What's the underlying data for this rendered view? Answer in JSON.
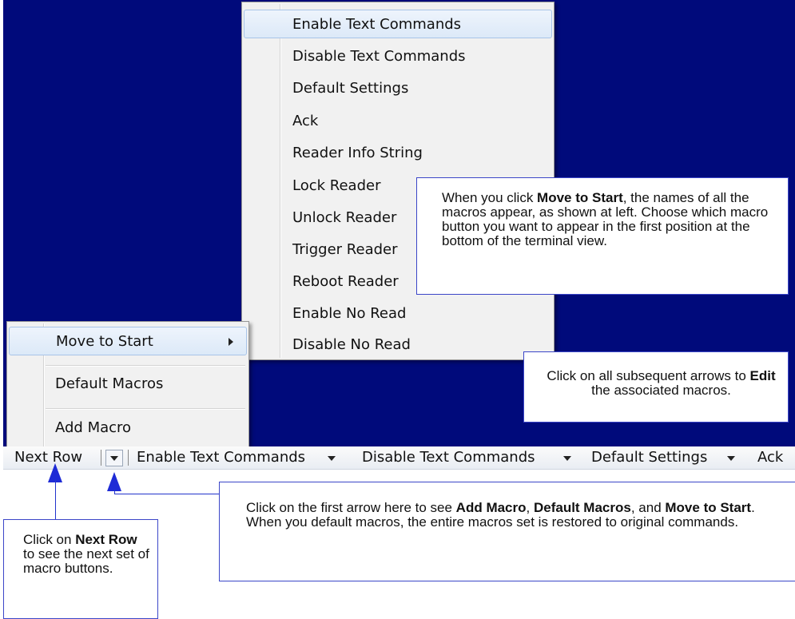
{
  "toolbar": {
    "next_row": "Next Row",
    "items": [
      "Enable Text Commands",
      "Disable Text Commands",
      "Default Settings",
      "Ack"
    ]
  },
  "macro_list_menu": {
    "items": [
      "Enable Text Commands",
      "Disable Text Commands",
      "Default Settings",
      "Ack",
      "Reader Info String",
      "Lock Reader",
      "Unlock Reader",
      "Trigger Reader",
      "Reboot Reader",
      "Enable No Read",
      "Disable No Read"
    ]
  },
  "context_menu": {
    "move_to_start": "Move to Start",
    "default_macros": "Default Macros",
    "add_macro": "Add Macro"
  },
  "callouts": {
    "move_to_start": {
      "p1": "When you click ",
      "b1": "Move to Start",
      "p2": ", the names of all the macros appear, as shown at left. Choose which macro button you want to appear in the first position at the bottom of the terminal view."
    },
    "edit": {
      "p1": "Click on all subsequent arrows to ",
      "b1": "Edit",
      "p2": " the associated macros."
    },
    "first_arrow": {
      "p1": "Click on the first arrow here to see ",
      "b1": "Add Macro",
      "p2": ", ",
      "b2": "Default Macros",
      "p3": ", and ",
      "b3": "Move to Start",
      "p4": ".",
      "p5": "When you default macros, the entire macros set is restored to original commands."
    },
    "next_row": {
      "p1": "Click on ",
      "b1": "Next Row",
      "p2": " to see the next set of macro buttons."
    }
  },
  "colors": {
    "terminal_bg": "#000a7b",
    "callout_border": "#3b46c8",
    "arrow": "#1e2bd6"
  }
}
